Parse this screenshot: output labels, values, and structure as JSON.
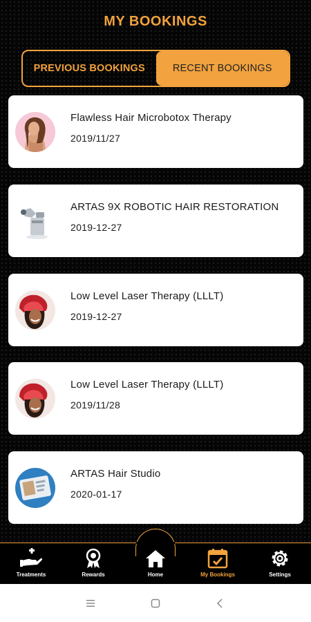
{
  "header": {
    "title": "MY BOOKINGS"
  },
  "tabs": {
    "previous": "PREVIOUS BOOKINGS",
    "recent": "RECENT BOOKINGS",
    "active": "recent"
  },
  "bookings": [
    {
      "title": "Flawless Hair Microbotox Therapy",
      "date": "2019/11/27",
      "image": "woman-portrait"
    },
    {
      "title": "ARTAS 9X ROBOTIC HAIR RESTORATION",
      "date": "2019-12-27",
      "image": "robotic-device"
    },
    {
      "title": "Low Level Laser Therapy (LLLT)",
      "date": "2019-12-27",
      "image": "laser-cap-woman"
    },
    {
      "title": "Low Level Laser Therapy (LLLT)",
      "date": "2019/11/28",
      "image": "laser-cap-woman"
    },
    {
      "title": "ARTAS Hair Studio",
      "date": "2020-01-17",
      "image": "tablet-app"
    }
  ],
  "nav": {
    "treatments": "Treatments",
    "rewards": "Rewards",
    "home": "Home",
    "my_bookings": "My Bookings",
    "settings": "Settings",
    "active": "my_bookings"
  },
  "colors": {
    "accent": "#f2a23e",
    "background": "#050505",
    "card": "#ffffff"
  }
}
